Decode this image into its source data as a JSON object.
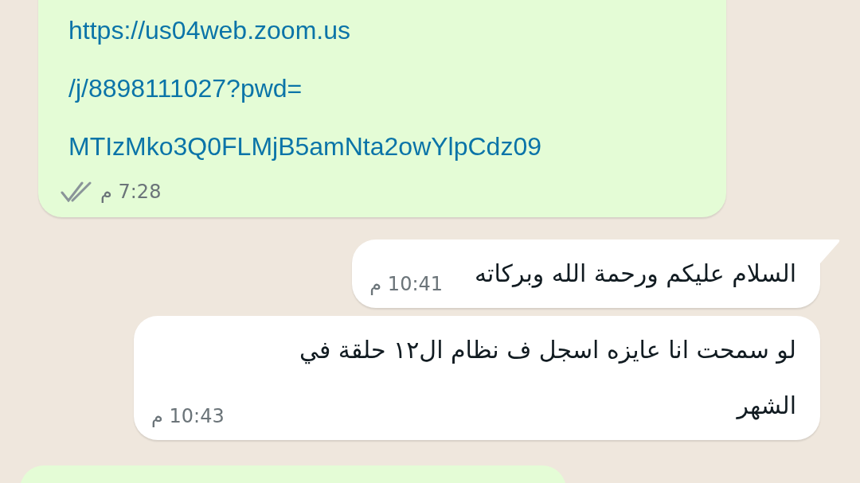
{
  "messages": [
    {
      "kind": "outgoing",
      "link_lines": [
        "https://us04web.zoom.us",
        "/j/8898111027?pwd=",
        "MTIzMko3Q0FLMjB5amNta2owYlpCdz09"
      ],
      "time": "7:28 م",
      "read": false
    },
    {
      "kind": "incoming",
      "text": "السلام عليكم ورحمة الله وبركاته",
      "time": "10:41 م",
      "tail": true
    },
    {
      "kind": "incoming",
      "text": "لو سمحت انا عايزه اسجل ف نظام ال١٢ حلقة في الشهر",
      "time": "10:43 م",
      "tail": false
    },
    {
      "kind": "outgoing_cut"
    }
  ]
}
